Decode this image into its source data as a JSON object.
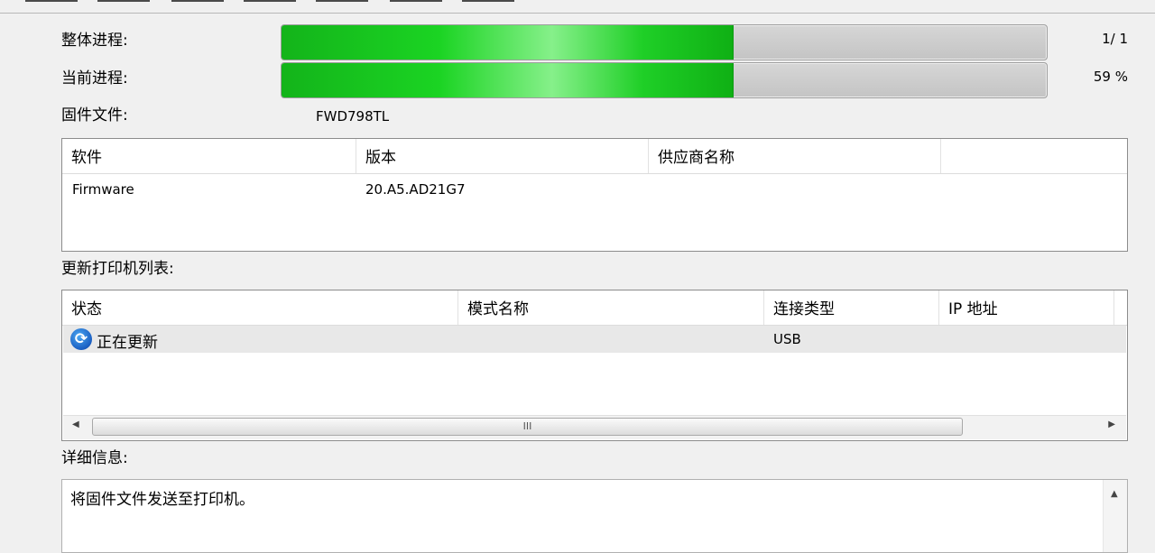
{
  "progress": {
    "overall_label": "整体进程:",
    "overall_value": "1/ 1",
    "overall_fraction": 0.59,
    "current_label": "当前进程:",
    "current_value": "59 %",
    "current_fraction": 0.59
  },
  "firmware": {
    "label": "固件文件:",
    "value": "FWD798TL"
  },
  "software_table": {
    "columns": [
      "软件",
      "版本",
      "供应商名称",
      ""
    ],
    "rows": [
      [
        "Firmware",
        "20.A5.AD21G7",
        "",
        ""
      ]
    ]
  },
  "printer_list": {
    "label": "更新打印机列表:",
    "columns": [
      "状态",
      "模式名称",
      "连接类型",
      "IP 地址"
    ],
    "rows": [
      [
        "正在更新",
        "",
        "USB",
        ""
      ]
    ],
    "status_icon": "refresh-icon"
  },
  "details": {
    "label": "详细信息:",
    "text": "将固件文件发送至打印机。"
  },
  "scrollbar": {
    "thumb_grip": "III"
  },
  "colors": {
    "progress_fill": "#1bd423",
    "progress_track": "#c8c8c8",
    "selected_row": "#e8e8e8"
  }
}
